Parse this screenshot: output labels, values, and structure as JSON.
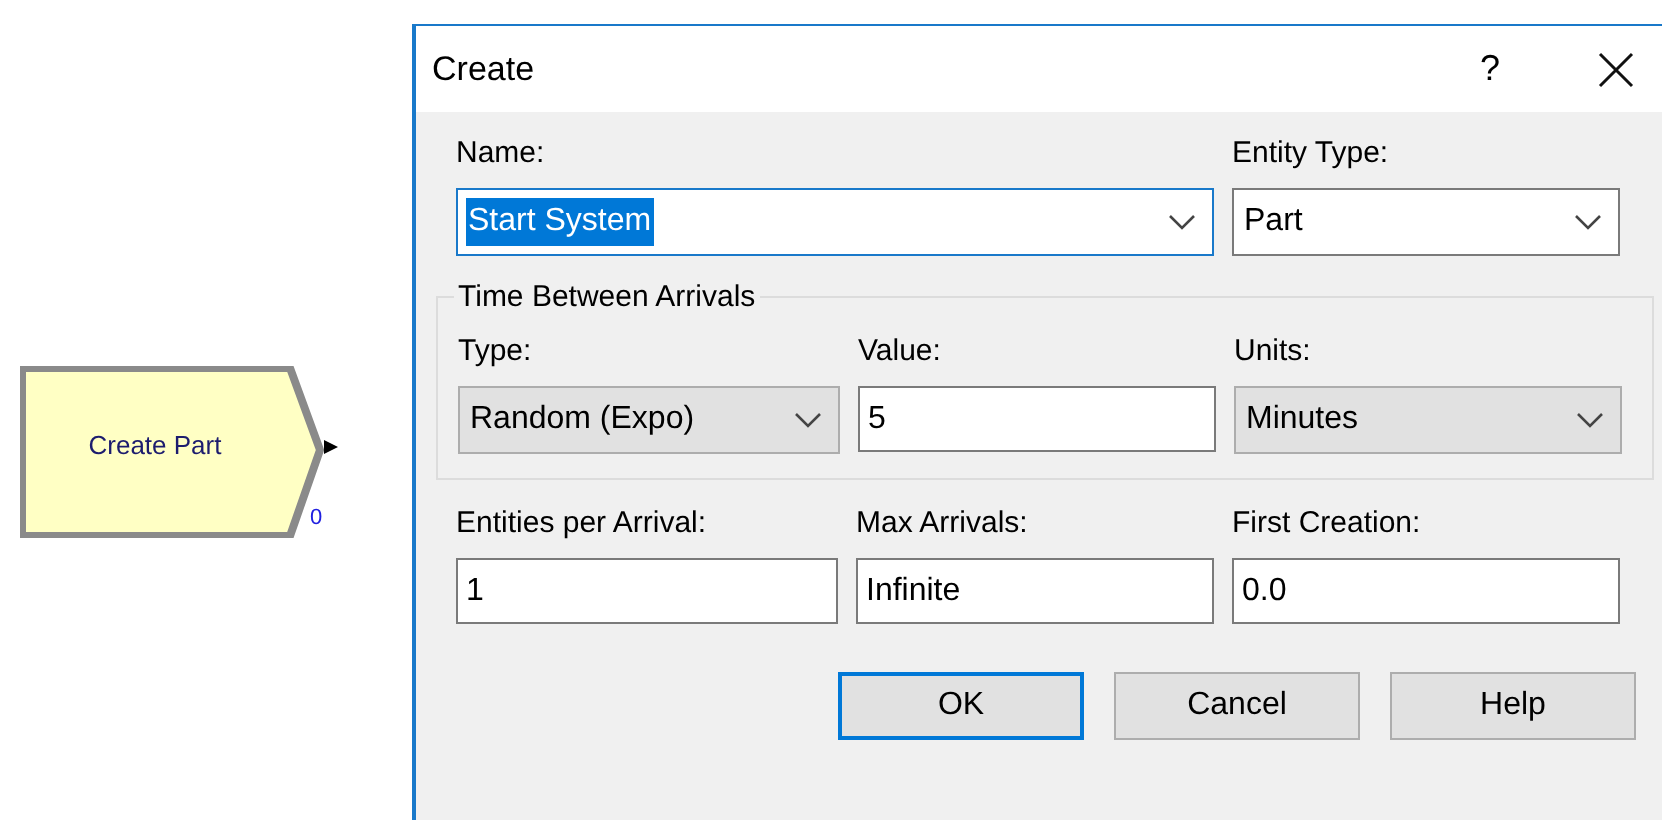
{
  "module": {
    "label": "Create Part",
    "count": "0"
  },
  "dialog": {
    "title": "Create",
    "help": "?",
    "top_fields": [
      {
        "label": "Name:",
        "kind": "combo",
        "value": "Start System",
        "highlighted": true
      },
      {
        "label": "Entity Type:",
        "kind": "combo",
        "value": "Part"
      }
    ],
    "group": {
      "title": "Time Between Arrivals",
      "fields": [
        {
          "label": "Type:",
          "kind": "list",
          "value": "Random (Expo)"
        },
        {
          "label": "Value:",
          "kind": "text",
          "value": "5"
        },
        {
          "label": "Units:",
          "kind": "list",
          "value": "Minutes"
        }
      ]
    },
    "bottom_fields": [
      {
        "label": "Entities per Arrival:",
        "kind": "text",
        "value": "1"
      },
      {
        "label": "Max Arrivals:",
        "kind": "text",
        "value": "Infinite"
      },
      {
        "label": "First Creation:",
        "kind": "text",
        "value": "0.0"
      }
    ],
    "buttons": [
      {
        "label": "OK",
        "default": true
      },
      {
        "label": "Cancel",
        "default": false
      },
      {
        "label": "Help",
        "default": false
      }
    ]
  }
}
